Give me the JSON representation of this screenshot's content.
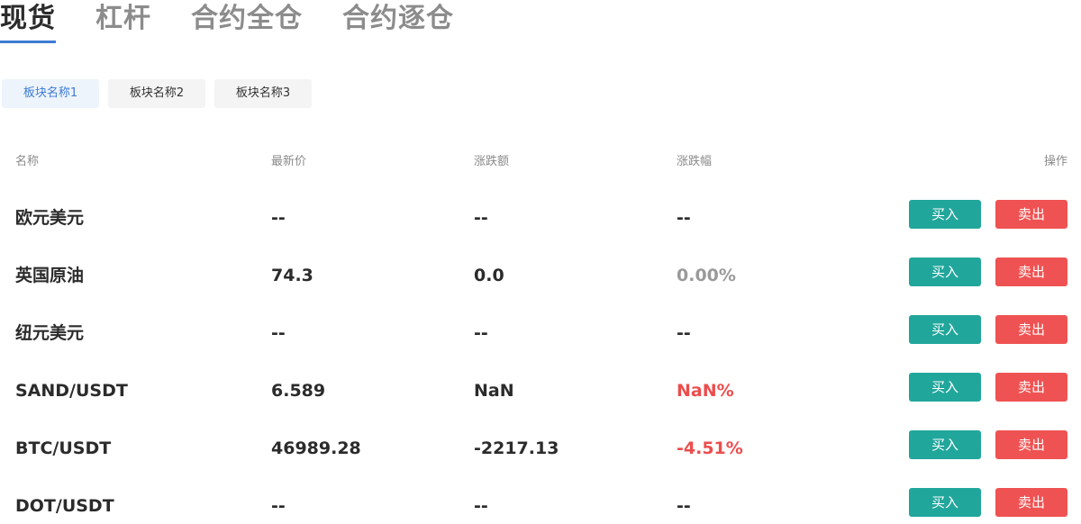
{
  "tabs": [
    {
      "label": "现货",
      "active": true
    },
    {
      "label": "杠杆",
      "active": false
    },
    {
      "label": "合约全仓",
      "active": false
    },
    {
      "label": "合约逐仓",
      "active": false
    }
  ],
  "chips": [
    {
      "label": "板块名称1",
      "active": true
    },
    {
      "label": "板块名称2",
      "active": false
    },
    {
      "label": "板块名称3",
      "active": false
    }
  ],
  "table": {
    "headers": {
      "name": "名称",
      "price": "最新价",
      "change": "涨跌额",
      "pct": "涨跌幅",
      "op": "操作"
    },
    "buy_label": "买入",
    "sell_label": "卖出",
    "rows": [
      {
        "name": "欧元美元",
        "price": "--",
        "change": "--",
        "pct": "--",
        "pct_color": "#2b2b2b"
      },
      {
        "name": "英国原油",
        "price": "74.3",
        "change": "0.0",
        "pct": "0.00%",
        "pct_color": "#9a9a9a"
      },
      {
        "name": "纽元美元",
        "price": "--",
        "change": "--",
        "pct": "--",
        "pct_color": "#2b2b2b"
      },
      {
        "name": "SAND/USDT",
        "price": "6.589",
        "change": "NaN",
        "pct": "NaN%",
        "pct_color": "#ec4d4d"
      },
      {
        "name": "BTC/USDT",
        "price": "46989.28",
        "change": "-2217.13",
        "pct": "-4.51%",
        "pct_color": "#ec4d4d"
      },
      {
        "name": "DOT/USDT",
        "price": "--",
        "change": "--",
        "pct": "--",
        "pct_color": "#2b2b2b"
      }
    ]
  },
  "colors": {
    "accent": "#3d7bd4",
    "buy": "#21a69b",
    "sell": "#ef5252",
    "down": "#ec4d4d",
    "neutral": "#9a9a9a"
  }
}
